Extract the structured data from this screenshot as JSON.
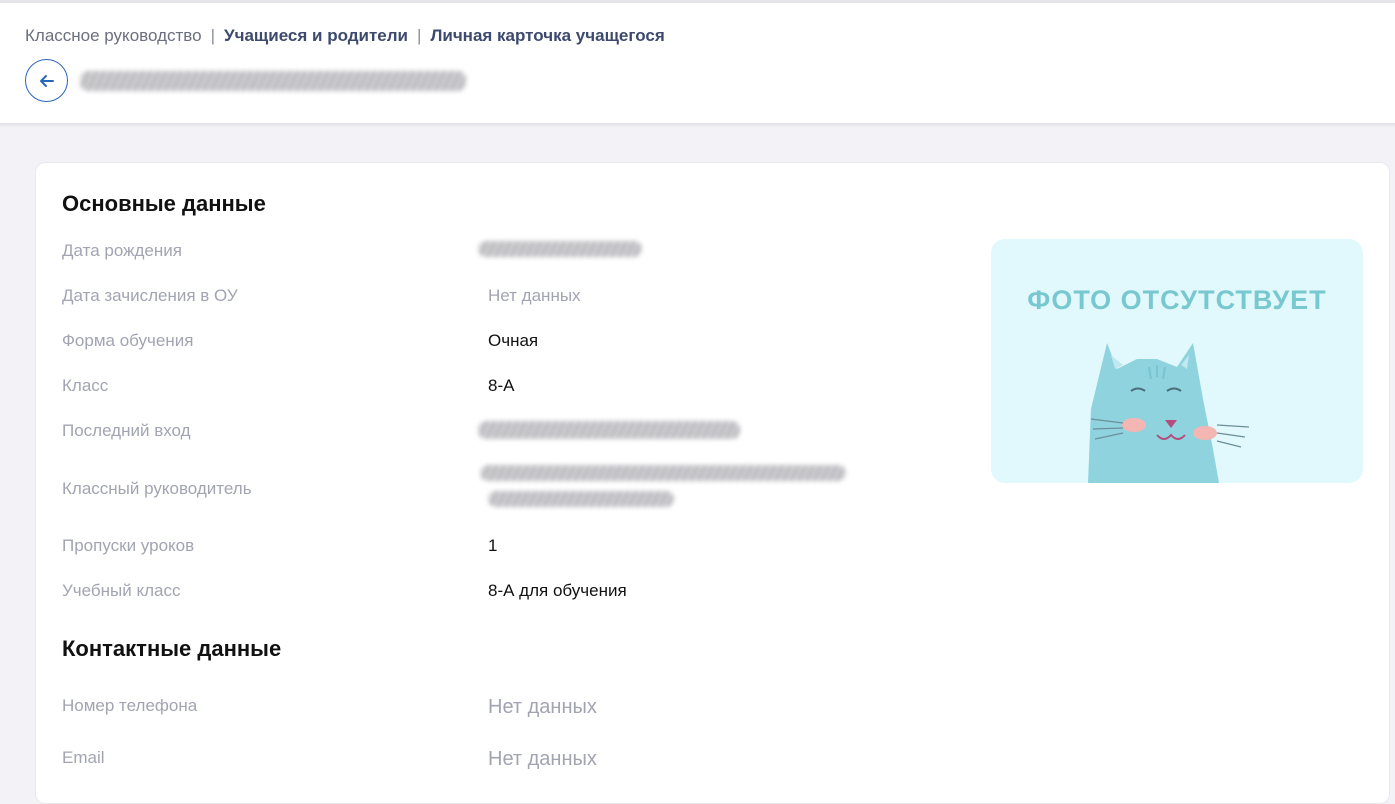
{
  "breadcrumb": {
    "items": [
      {
        "label": "Классное руководство"
      },
      {
        "label": "Учащиеся и родители"
      },
      {
        "label": "Личная карточка учащегося"
      }
    ],
    "separator": "|"
  },
  "header": {
    "back_icon": "arrow-left-icon"
  },
  "basic": {
    "title": "Основные данные",
    "rows": {
      "birth_date": {
        "label": "Дата рождения",
        "value": ""
      },
      "enrollment_date": {
        "label": "Дата зачисления в ОУ",
        "value": "Нет данных"
      },
      "study_form": {
        "label": "Форма обучения",
        "value": "Очная"
      },
      "class": {
        "label": "Класс",
        "value": "8-А"
      },
      "last_login": {
        "label": "Последний вход",
        "value": ""
      },
      "class_teacher": {
        "label": "Классный руководитель",
        "value": ""
      },
      "absences": {
        "label": "Пропуски уроков",
        "value": "1"
      },
      "study_class": {
        "label": "Учебный класс",
        "value": "8-А для обучения"
      }
    },
    "photo": {
      "placeholder_text": "ФОТО ОТСУТСТВУЕТ",
      "icon": "cat-placeholder-icon",
      "bg_color": "#e1f8fc"
    }
  },
  "contacts": {
    "title": "Контактные данные",
    "rows": {
      "phone": {
        "label": "Номер телефона",
        "value": "Нет данных"
      },
      "email": {
        "label": "Email",
        "value": "Нет данных"
      }
    }
  },
  "colors": {
    "accent": "#2a66b8",
    "label": "#a2a4b2",
    "breadcrumb_bold": "#3d4a6e"
  }
}
